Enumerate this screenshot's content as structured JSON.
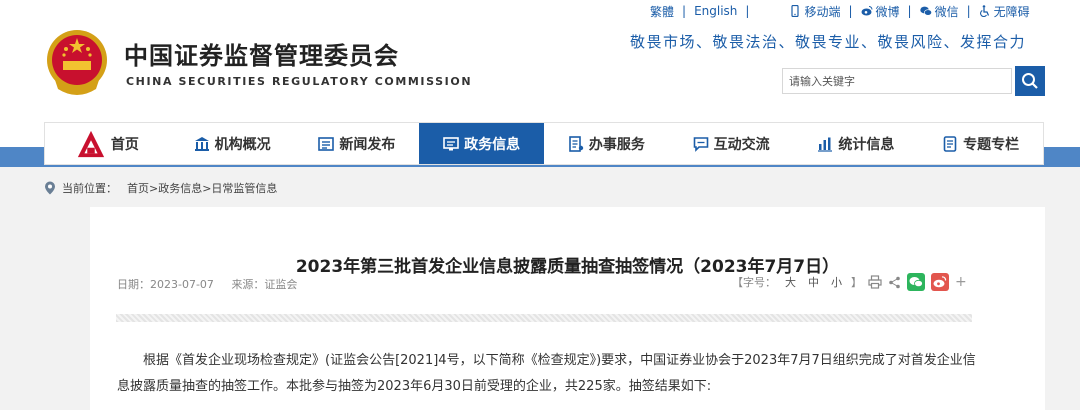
{
  "header": {
    "site_title": "中国证券监督管理委员会",
    "site_subtitle": "CHINA SECURITIES REGULATORY COMMISSION",
    "slogan": "敬畏市场、敬畏法治、敬畏专业、敬畏风险、发挥合力",
    "top_links": [
      "繁體",
      "English",
      "移动端",
      "微博",
      "微信",
      "无障碍"
    ],
    "search_placeholder": "请输入关键字"
  },
  "nav": {
    "items": [
      {
        "label": "首页",
        "icon": "csrc-logo-icon"
      },
      {
        "label": "机构概况",
        "icon": "building-icon"
      },
      {
        "label": "新闻发布",
        "icon": "newspaper-icon"
      },
      {
        "label": "政务信息",
        "icon": "monitor-icon",
        "active": true
      },
      {
        "label": "办事服务",
        "icon": "document-list-icon"
      },
      {
        "label": "互动交流",
        "icon": "chat-icon"
      },
      {
        "label": "统计信息",
        "icon": "bar-chart-icon"
      },
      {
        "label": "专题专栏",
        "icon": "document-icon"
      }
    ]
  },
  "breadcrumb": {
    "prefix": "当前位置：",
    "path": [
      "首页",
      ">政务信息",
      ">日常监管信息"
    ]
  },
  "article": {
    "title": "2023年第三批首发企业信息披露质量抽查抽签情况（2023年7月7日）",
    "date_label": "日期：2023-07-07",
    "source_label": "来源：证监会",
    "font_size_label": "【字号：",
    "font_sizes": [
      "大",
      "中",
      "小"
    ],
    "font_size_close": "】",
    "body": "根据《首发企业现场检查规定》(证监会公告[2021]4号，以下简称《检查规定》)要求，中国证券业协会于2023年7月7日组织完成了对首发企业信息披露质量抽查的抽签工作。本批参与抽签为2023年6月30日前受理的企业，共225家。抽签结果如下:"
  },
  "colors": {
    "brand_blue": "#1b5da8",
    "stripe_blue": "#4f86c6",
    "wechat_green": "#2db55d",
    "weibo_red": "#e2564e"
  }
}
